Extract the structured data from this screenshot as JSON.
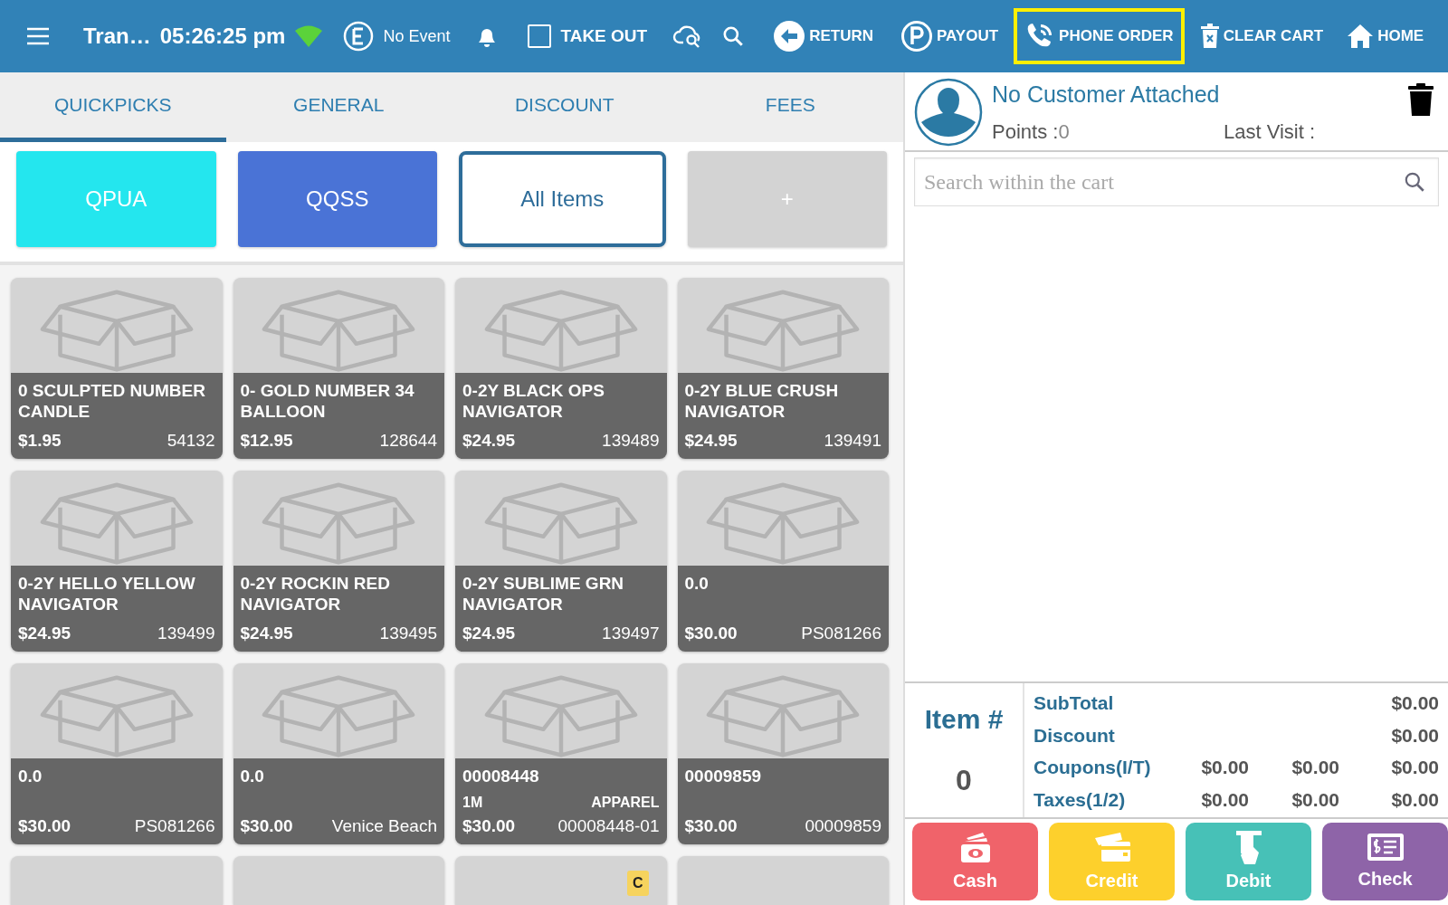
{
  "top_bar": {
    "transaction": "Tran…",
    "time": "05:26:25 pm",
    "event": "No Event",
    "take_out": {
      "label": "TAKE OUT",
      "checked": false
    },
    "actions": [
      {
        "label": "RETURN",
        "highlighted": false
      },
      {
        "label": "PAYOUT",
        "highlighted": false
      },
      {
        "label": "PHONE ORDER",
        "highlighted": true
      },
      {
        "label": "CLEAR CART",
        "highlighted": false
      },
      {
        "label": "HOME",
        "highlighted": false
      }
    ]
  },
  "tabs": [
    {
      "label": "QUICKPICKS",
      "selected": true
    },
    {
      "label": "GENERAL",
      "selected": false
    },
    {
      "label": "DISCOUNT",
      "selected": false
    },
    {
      "label": "FEES",
      "selected": false
    }
  ],
  "categories": [
    {
      "label": "QPUA",
      "color": "#24e6ee",
      "selected": false
    },
    {
      "label": "QQSS",
      "color": "#4a73d6",
      "selected": false
    },
    {
      "label": "All Items",
      "color": "#ffffff",
      "selected": true
    },
    {
      "label": "+",
      "color": "#d3d3d3",
      "selected": false
    }
  ],
  "items": [
    {
      "kind": "full",
      "name": "0 SCULPTED NUMBER CANDLE",
      "price": "$1.95",
      "code": "54132"
    },
    {
      "kind": "full",
      "name": "0- GOLD NUMBER 34 BALLOON",
      "price": "$12.95",
      "code": "128644"
    },
    {
      "kind": "full",
      "name": "0-2Y BLACK OPS NAVIGATOR",
      "price": "$24.95",
      "code": "139489"
    },
    {
      "kind": "full",
      "name": "0-2Y BLUE CRUSH NAVIGATOR",
      "price": "$24.95",
      "code": "139491"
    },
    {
      "kind": "full",
      "name": "0-2Y HELLO YELLOW NAVIGATOR",
      "price": "$24.95",
      "code": "139499"
    },
    {
      "kind": "full",
      "name": "0-2Y ROCKIN RED NAVIGATOR",
      "price": "$24.95",
      "code": "139495"
    },
    {
      "kind": "full",
      "name": "0-2Y SUBLIME GRN NAVIGATOR",
      "price": "$24.95",
      "code": "139497"
    },
    {
      "kind": "full",
      "name": "0.0",
      "price": "$30.00",
      "code": "PS081266"
    },
    {
      "kind": "full",
      "name": "0.0",
      "price": "$30.00",
      "code": "PS081266"
    },
    {
      "kind": "full",
      "name": "0.0",
      "price": "$30.00",
      "code": "Venice Beach"
    },
    {
      "kind": "full",
      "name": "00008448",
      "size": "1M",
      "department": "APPAREL",
      "price": "$30.00",
      "code": "00008448-01"
    },
    {
      "kind": "full",
      "name": "00009859",
      "price": "$30.00",
      "code": "00009859"
    },
    {
      "kind": "partial"
    },
    {
      "kind": "partial"
    },
    {
      "kind": "partial",
      "badge": "C"
    },
    {
      "kind": "partial"
    }
  ],
  "customer": {
    "name": "No Customer Attached",
    "points_label": "Points :",
    "points": "0",
    "last_visit_label": "Last Visit :"
  },
  "cart_search": {
    "placeholder": "Search within the cart"
  },
  "summary": {
    "item_label": "Item #",
    "item_count": "0",
    "rows": [
      {
        "label": "SubTotal",
        "values": [
          "$0.00"
        ]
      },
      {
        "label": "Discount",
        "values": [
          "$0.00"
        ]
      },
      {
        "label": "Coupons(I/T)",
        "values": [
          "$0.00",
          "$0.00",
          "$0.00"
        ]
      },
      {
        "label": "Taxes(1/2)",
        "values": [
          "$0.00",
          "$0.00",
          "$0.00"
        ]
      }
    ]
  },
  "payments": [
    {
      "label": "Cash",
      "color": "#f0636a"
    },
    {
      "label": "Credit",
      "color": "#fdd02c"
    },
    {
      "label": "Debit",
      "color": "#47c1b7"
    },
    {
      "label": "Check",
      "color": "#8e64a8"
    }
  ]
}
